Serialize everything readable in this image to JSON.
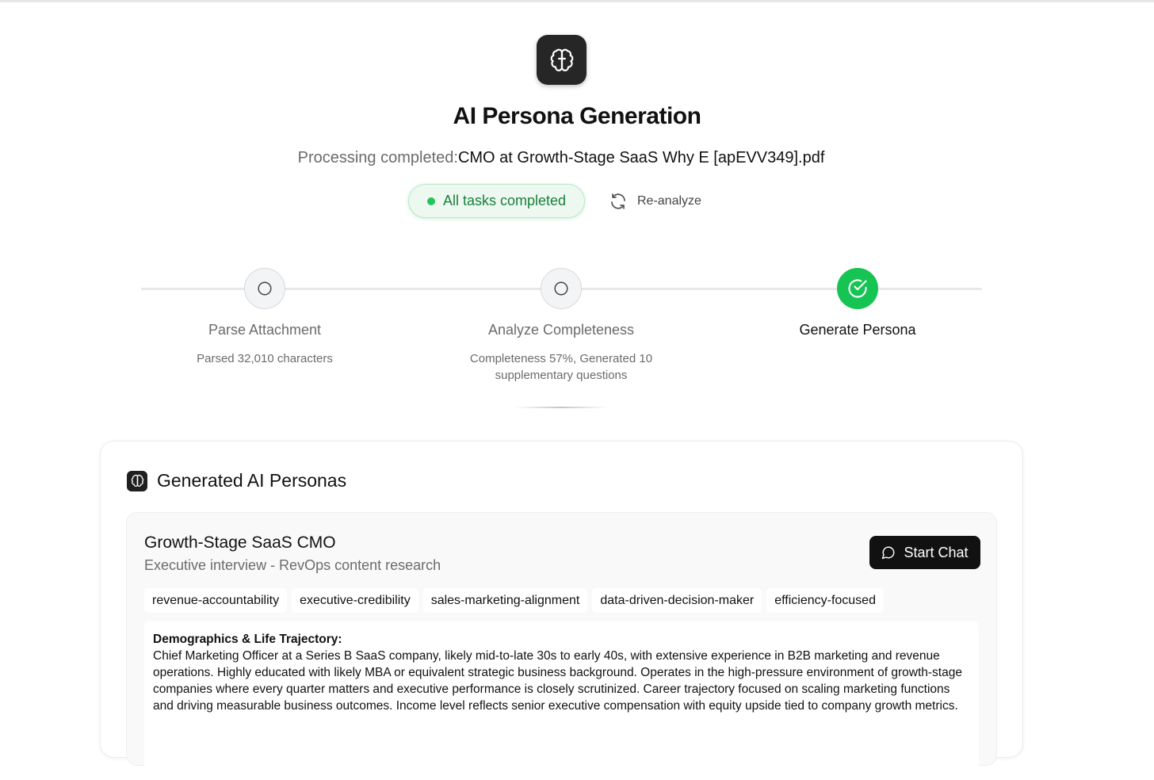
{
  "header": {
    "title": "AI Persona Generation",
    "processing_label": "Processing completed:",
    "file_name": "CMO at Growth-Stage SaaS Why E [apEVV349].pdf",
    "status": "All tasks completed",
    "reanalyze_label": "Re-analyze",
    "logo_icon": "brain-icon"
  },
  "steps": [
    {
      "label": "Parse Attachment",
      "description": "Parsed 32,010 characters",
      "state": "pending"
    },
    {
      "label": "Analyze Completeness",
      "description": "Completeness 57%, Generated 10 supplementary questions",
      "state": "pending"
    },
    {
      "label": "Generate Persona",
      "description": "",
      "state": "done"
    }
  ],
  "personas_section": {
    "title": "Generated AI Personas",
    "personas": [
      {
        "name": "Growth-Stage SaaS CMO",
        "subtitle": "Executive interview - RevOps content research",
        "start_chat_label": "Start Chat",
        "tags": [
          "revenue-accountability",
          "executive-credibility",
          "sales-marketing-alignment",
          "data-driven-decision-maker",
          "efficiency-focused"
        ],
        "section_title": "Demographics & Life Trajectory:",
        "section_text": "Chief Marketing Officer at a Series B SaaS company, likely mid-to-late 30s to early 40s, with extensive experience in B2B marketing and revenue operations. Highly educated with likely MBA or equivalent strategic business background. Operates in the high-pressure environment of growth-stage companies where every quarter matters and executive performance is closely scrutinized. Career trajectory focused on scaling marketing functions and driving measurable business outcomes. Income level reflects senior executive compensation with equity upside tied to company growth metrics."
      }
    ]
  },
  "colors": {
    "accent_green": "#16c454",
    "status_text": "#1a7f3c",
    "dark": "#111111"
  }
}
